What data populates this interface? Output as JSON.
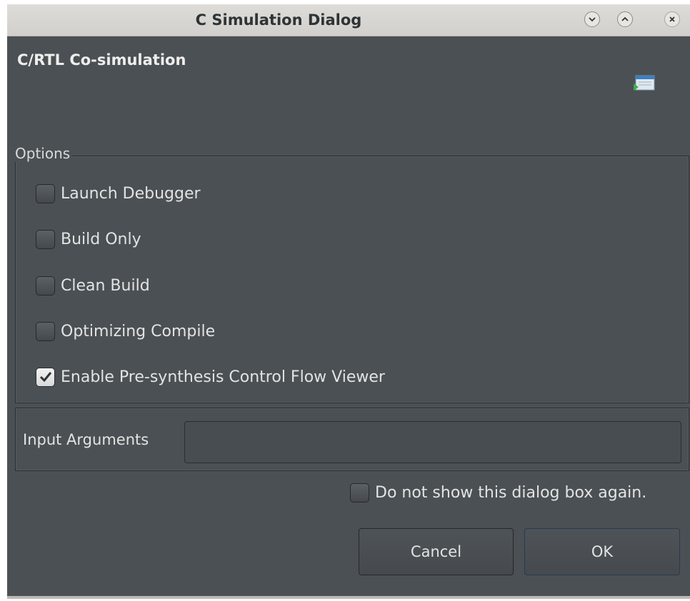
{
  "window": {
    "title": "C Simulation Dialog"
  },
  "header": {
    "title": "C/RTL Co-simulation",
    "icon": "simulation-window-icon"
  },
  "options": {
    "legend": "Options",
    "items": [
      {
        "label": "Launch Debugger",
        "checked": false
      },
      {
        "label": "Build Only",
        "checked": false
      },
      {
        "label": "Clean Build",
        "checked": false
      },
      {
        "label": "Optimizing Compile",
        "checked": false
      },
      {
        "label": "Enable Pre-synthesis Control Flow Viewer",
        "checked": true
      }
    ]
  },
  "input_arguments": {
    "label": "Input Arguments",
    "value": "",
    "placeholder": ""
  },
  "dont_show": {
    "label": "Do not show this dialog box again.",
    "checked": false
  },
  "buttons": {
    "cancel": "Cancel",
    "ok": "OK"
  },
  "colors": {
    "window_bg": "#4b5054",
    "titlebar_bg": "#d2d0cc",
    "text": "#e2e3e3",
    "ok_border": "#2a3a4e"
  }
}
